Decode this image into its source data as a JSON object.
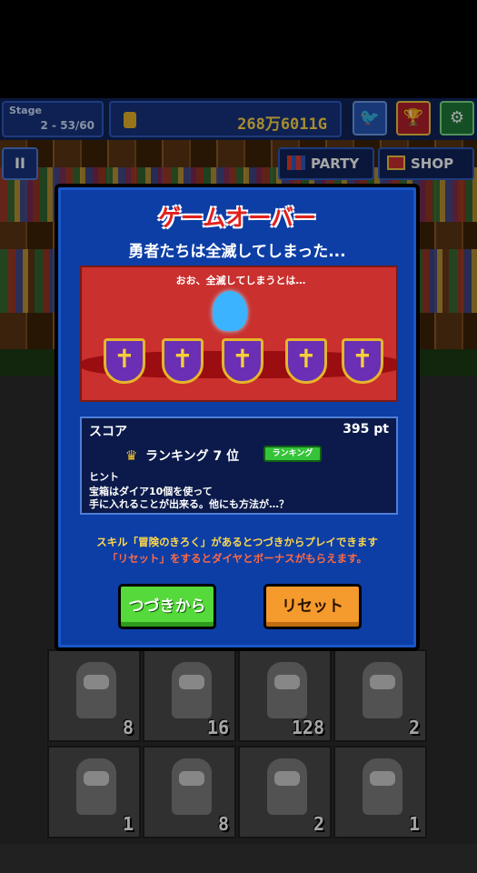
{
  "hud": {
    "stage_label": "Stage",
    "stage_value": "2 - 53/60",
    "gold_value": "268万6011G",
    "twitter_icon": "twitter-icon",
    "trophy_icon": "trophy-icon",
    "settings_icon": "gear-icon"
  },
  "nav": {
    "pause_label": "II",
    "party_label": "PARTY",
    "shop_label": "SHOP"
  },
  "modal": {
    "title": "ゲームオーバー",
    "subtitle": "勇者たちは全滅してしまった...",
    "speech": "おお、全滅してしまうとは…",
    "score_label": "スコア",
    "score_value": "395 pt",
    "ranking_text": "ランキング 7 位",
    "ranking_badge": "ランキング",
    "hint_label": "ヒント",
    "hint_line1": "宝箱はダイア10個を使って",
    "hint_line2": "手に入れることが出来る。他にも方法が…？",
    "note1": "スキル「冒険のきろく」があるとつづきからプレイできます",
    "note2": "「リセット」をするとダイヤとボーナスがもらえます。",
    "continue_button": "つづきから",
    "reset_button": "リセット"
  },
  "party_grid": [
    {
      "count": "8"
    },
    {
      "count": "16"
    },
    {
      "count": "128"
    },
    {
      "count": "2"
    },
    {
      "count": "1"
    },
    {
      "count": "8"
    },
    {
      "count": "2"
    },
    {
      "count": "1"
    }
  ],
  "colors": {
    "modal_bg": "#0d3ea6",
    "title_red": "#e2201c",
    "continue_green": "#56d93a",
    "reset_orange": "#f59a2c",
    "gold_yellow": "#ffd84a"
  }
}
